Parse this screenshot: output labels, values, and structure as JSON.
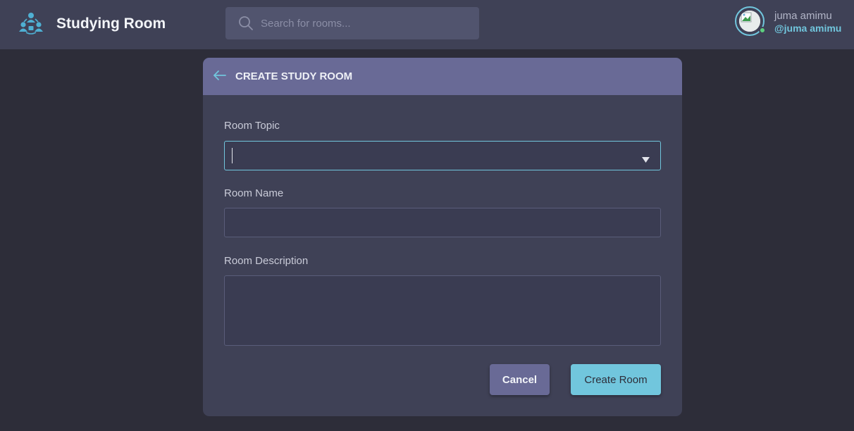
{
  "app": {
    "brand": "Studying Room",
    "logo_icon": "people-network-icon",
    "accent_color": "#71c6dd"
  },
  "search": {
    "placeholder": "Search for rooms...",
    "value": ""
  },
  "user": {
    "name": "juma amimu",
    "handle": "@juma amimu",
    "status": "online"
  },
  "modal": {
    "title": "CREATE STUDY ROOM",
    "back_icon": "arrow-left-icon",
    "fields": {
      "topic": {
        "label": "Room Topic",
        "value": ""
      },
      "name": {
        "label": "Room Name",
        "value": ""
      },
      "description": {
        "label": "Room Description",
        "value": ""
      }
    },
    "buttons": {
      "cancel": "Cancel",
      "create": "Create Room"
    }
  }
}
